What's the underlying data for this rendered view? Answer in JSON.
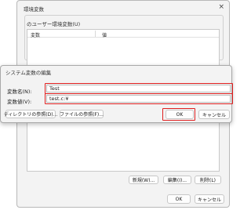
{
  "back_window": {
    "title": "環境変数",
    "close_glyph": "×",
    "user_group_label": "のユーザー環境変数(U)",
    "columns": [
      "変数",
      "値"
    ],
    "buttons": {
      "new": "新規(W)...",
      "edit": "編集(I)...",
      "delete": "削除(L)"
    },
    "ok": "OK",
    "cancel": "キャンセル"
  },
  "dialog": {
    "title": "システム変数の編集",
    "name_label": "変数名(N):",
    "value_label": "変数値(V):",
    "name_value": "Test",
    "value_value": "test.c:¥",
    "browse_dir": "ディレクトリの参照(D)...",
    "browse_file": "ファイルの参照(F)...",
    "ok": "OK",
    "cancel": "キャンセル"
  },
  "colors": {
    "highlight": "#e02020"
  }
}
